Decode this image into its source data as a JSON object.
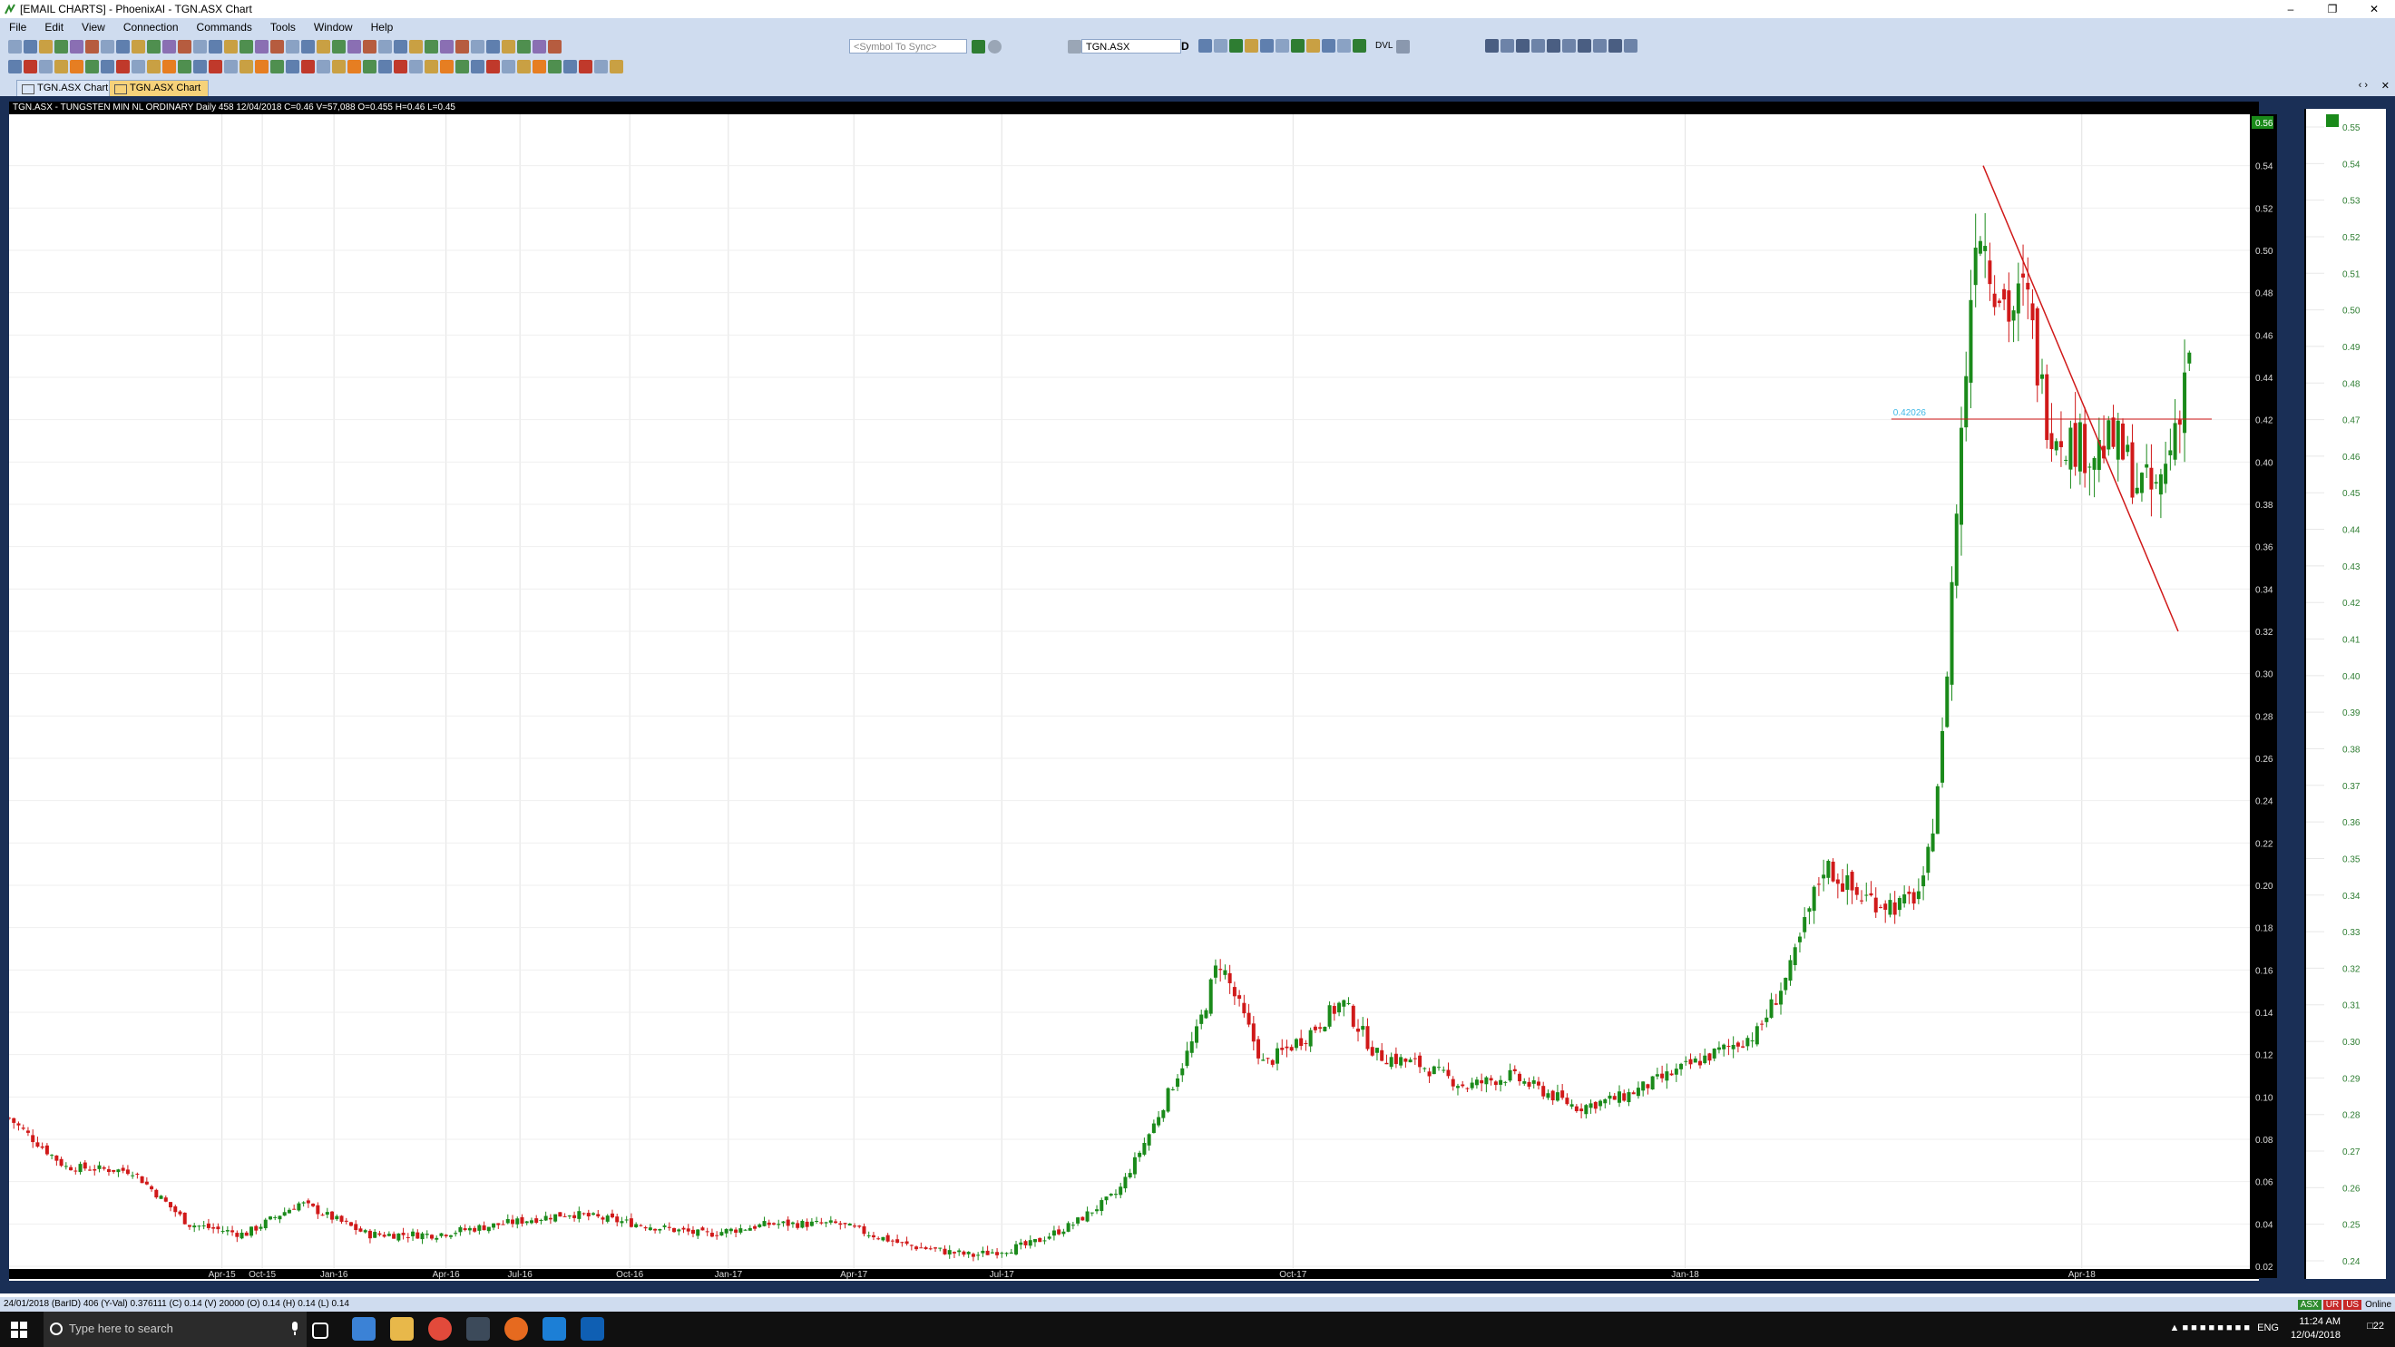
{
  "window": {
    "title": "[EMAIL CHARTS] - PhoenixAI - TGN.ASX  Chart",
    "minimize_icon": "minimize-icon",
    "maximize_icon": "restore-icon",
    "close_icon": "close-icon"
  },
  "menu": [
    "File",
    "Edit",
    "View",
    "Connection",
    "Commands",
    "Tools",
    "Window",
    "Help"
  ],
  "toolbar": {
    "sync_placeholder": "<Symbol To Sync>",
    "symbol_value": "TGN.ASX",
    "period_value": "D",
    "dvl_label": "DVL"
  },
  "tabs": [
    {
      "label": "TGN.ASX  Chart",
      "active": false
    },
    {
      "label": "TGN.ASX  Chart",
      "active": true
    }
  ],
  "chart": {
    "header": "TGN.ASX - TUNGSTEN MIN NL ORDINARY Daily 458 12/04/2018 C=0.46 V=57,088 O=0.455 H=0.46 L=0.45",
    "hline_label": "0.42026",
    "right_top_label": "0.56"
  },
  "chart_data": {
    "type": "candlestick",
    "title": "TGN.ASX - TUNGSTEN MIN NL ORDINARY Daily",
    "ylim": [
      0.02,
      0.56
    ],
    "y_ticks": [
      "0.54",
      "0.52",
      "0.50",
      "0.48",
      "0.46",
      "0.44",
      "0.42",
      "0.40",
      "0.38",
      "0.36",
      "0.34",
      "0.32",
      "0.30",
      "0.28",
      "0.26",
      "0.24",
      "0.22",
      "0.20",
      "0.18",
      "0.16",
      "0.14",
      "0.12",
      "0.10",
      "0.08",
      "0.06",
      "0.04",
      "0.02"
    ],
    "x_ticks": [
      "Apr-15",
      "Oct-15",
      "Jan-16",
      "Apr-16",
      "Jul-16",
      "Oct-16",
      "Jan-17",
      "Apr-17",
      "Jul-17",
      "Oct-17",
      "Jan-18",
      "Apr-18"
    ],
    "right_scale_ticks": [
      "0.55",
      "0.54",
      "0.53",
      "0.52",
      "0.51",
      "0.50",
      "0.49",
      "0.48",
      "0.47",
      "0.46",
      "0.45",
      "0.44",
      "0.43",
      "0.42",
      "0.41",
      "0.40",
      "0.39",
      "0.38",
      "0.37",
      "0.36",
      "0.35",
      "0.34",
      "0.33",
      "0.32",
      "0.31",
      "0.30",
      "0.29",
      "0.28",
      "0.27",
      "0.26",
      "0.25",
      "0.24"
    ],
    "price_path": [
      [
        0.0,
        0.09
      ],
      [
        2.5,
        0.067
      ],
      [
        5.5,
        0.065
      ],
      [
        8.0,
        0.04
      ],
      [
        10.5,
        0.035
      ],
      [
        13.0,
        0.05
      ],
      [
        16.0,
        0.035
      ],
      [
        19.0,
        0.035
      ],
      [
        22.0,
        0.04
      ],
      [
        25.0,
        0.045
      ],
      [
        28.0,
        0.04
      ],
      [
        31.0,
        0.035
      ],
      [
        34.0,
        0.04
      ],
      [
        37.0,
        0.04
      ],
      [
        40.0,
        0.03
      ],
      [
        43.0,
        0.025
      ],
      [
        45.5,
        0.03
      ],
      [
        47.5,
        0.04
      ],
      [
        49.5,
        0.055
      ],
      [
        51.0,
        0.085
      ],
      [
        53.0,
        0.13
      ],
      [
        54.0,
        0.165
      ],
      [
        55.0,
        0.14
      ],
      [
        56.0,
        0.115
      ],
      [
        58.0,
        0.13
      ],
      [
        59.5,
        0.145
      ],
      [
        61.0,
        0.12
      ],
      [
        63.0,
        0.115
      ],
      [
        65.0,
        0.105
      ],
      [
        67.0,
        0.11
      ],
      [
        70.0,
        0.095
      ],
      [
        72.0,
        0.1
      ],
      [
        74.0,
        0.11
      ],
      [
        76.0,
        0.12
      ],
      [
        78.0,
        0.13
      ],
      [
        79.5,
        0.16
      ],
      [
        81.0,
        0.21
      ],
      [
        82.5,
        0.195
      ],
      [
        84.5,
        0.19
      ],
      [
        85.5,
        0.2
      ],
      [
        86.3,
        0.27
      ],
      [
        86.8,
        0.36
      ],
      [
        87.3,
        0.44
      ],
      [
        87.8,
        0.52
      ],
      [
        88.5,
        0.49
      ],
      [
        89.3,
        0.47
      ],
      [
        90.0,
        0.48
      ],
      [
        90.6,
        0.44
      ],
      [
        91.0,
        0.42
      ],
      [
        92.0,
        0.41
      ],
      [
        93.0,
        0.405
      ],
      [
        94.0,
        0.41
      ],
      [
        95.0,
        0.39
      ],
      [
        95.8,
        0.385
      ],
      [
        96.3,
        0.4
      ],
      [
        96.9,
        0.43
      ],
      [
        97.3,
        0.455
      ]
    ],
    "x_unit": "percent of visible time range (Apr-15 to Apr-18+)",
    "horizontal_line": 0.42026,
    "trendline": {
      "from": [
        0.54
      ],
      "to": [
        0.32
      ]
    },
    "up_color": "#1a8a1a",
    "down_color": "#d01919"
  },
  "status": {
    "left": "24/01/2018  (BarID) 406  (Y-Val) 0.376111  (C) 0.14  (V) 20000  (O) 0.14  (H) 0.14  (L) 0.14",
    "badges": [
      "ASX",
      "UR",
      "US",
      "Online"
    ]
  },
  "taskbar": {
    "search_placeholder": "Type here to search",
    "lang": "ENG",
    "time": "11:24 AM",
    "date": "12/04/2018",
    "notif_count": "22"
  },
  "colors": {
    "frame": "#1a2f56",
    "chrome": "#cfdcef",
    "accent_tab": "#f6d27a"
  }
}
